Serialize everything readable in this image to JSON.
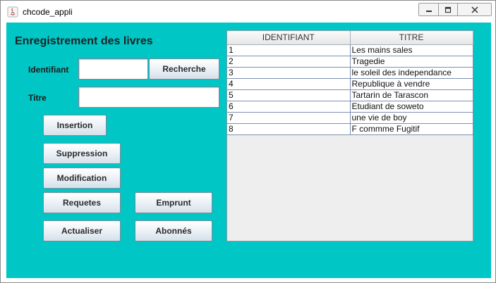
{
  "window": {
    "title": "chcode_appli",
    "controls": [
      "minimize-icon",
      "maximize-icon",
      "close-icon"
    ]
  },
  "form": {
    "heading": "Enregistrement des livres",
    "identifiant_label": "Identifiant",
    "identifiant_value": "",
    "titre_label": "Titre",
    "titre_value": ""
  },
  "buttons": {
    "recherche": "Recherche",
    "insertion": "Insertion",
    "suppression": "Suppression",
    "modification": "Modification",
    "requetes": "Requetes",
    "emprunt": "Emprunt",
    "actualiser": "Actualiser",
    "abonnes": "Abonnés"
  },
  "table": {
    "headers": [
      "IDENTIFIANT",
      "TITRE"
    ],
    "rows": [
      [
        "1",
        "Les mains sales"
      ],
      [
        "2",
        "Tragedie"
      ],
      [
        "3",
        "le soleil des independance"
      ],
      [
        "4",
        "Republique à vendre"
      ],
      [
        "5",
        "Tartarin de Tarascon"
      ],
      [
        "6",
        "Etudiant de soweto"
      ],
      [
        "7",
        "une vie de boy"
      ],
      [
        "8",
        "F commme Fugitif"
      ]
    ]
  },
  "colors": {
    "client_background": "#00c6c6"
  }
}
